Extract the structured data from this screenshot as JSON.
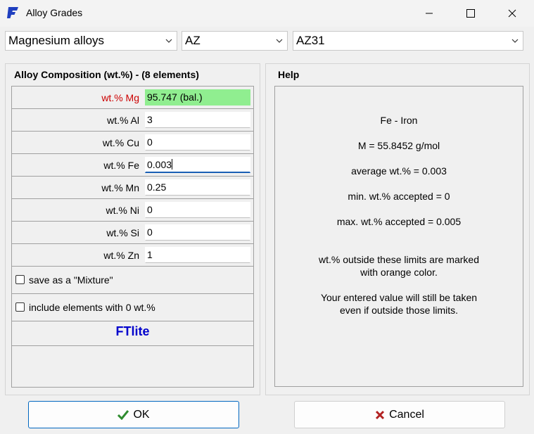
{
  "window": {
    "title": "Alloy Grades"
  },
  "selectors": {
    "family": "Magnesium alloys",
    "series": "AZ",
    "grade": "AZ31"
  },
  "composition": {
    "title": "Alloy Composition (wt.%) - (8 elements)",
    "rows": [
      {
        "label": "wt.% Mg",
        "value": "95.747 (bal.)"
      },
      {
        "label": "wt.% Al",
        "value": "3"
      },
      {
        "label": "wt.% Cu",
        "value": "0"
      },
      {
        "label": "wt.% Fe",
        "value": "0.003"
      },
      {
        "label": "wt.% Mn",
        "value": "0.25"
      },
      {
        "label": "wt.% Ni",
        "value": "0"
      },
      {
        "label": "wt.% Si",
        "value": "0"
      },
      {
        "label": "wt.% Zn",
        "value": "1"
      }
    ],
    "save_mixture_label": "save as a \"Mixture\"",
    "include_zero_label": "include elements with 0 wt.%",
    "brand": "FTlite"
  },
  "help": {
    "title": "Help",
    "element": "Fe - Iron",
    "molar_mass": "M = 55.8452 g/mol",
    "average": "average wt.% = 0.003",
    "min": "min. wt.% accepted = 0",
    "max": "max. wt.% accepted = 0.005",
    "note1_line1": "wt.% outside these limits are marked",
    "note1_line2": "with orange color.",
    "note2_line1": "Your entered value will still be taken",
    "note2_line2": "even if outside those limits."
  },
  "buttons": {
    "ok": "OK",
    "cancel": "Cancel"
  },
  "colors": {
    "balance_bg": "#90ee90",
    "balance_label": "#cc0000",
    "brand": "#0000cc",
    "ok_check": "#2e8b2e",
    "cancel_x": "#b22222"
  }
}
